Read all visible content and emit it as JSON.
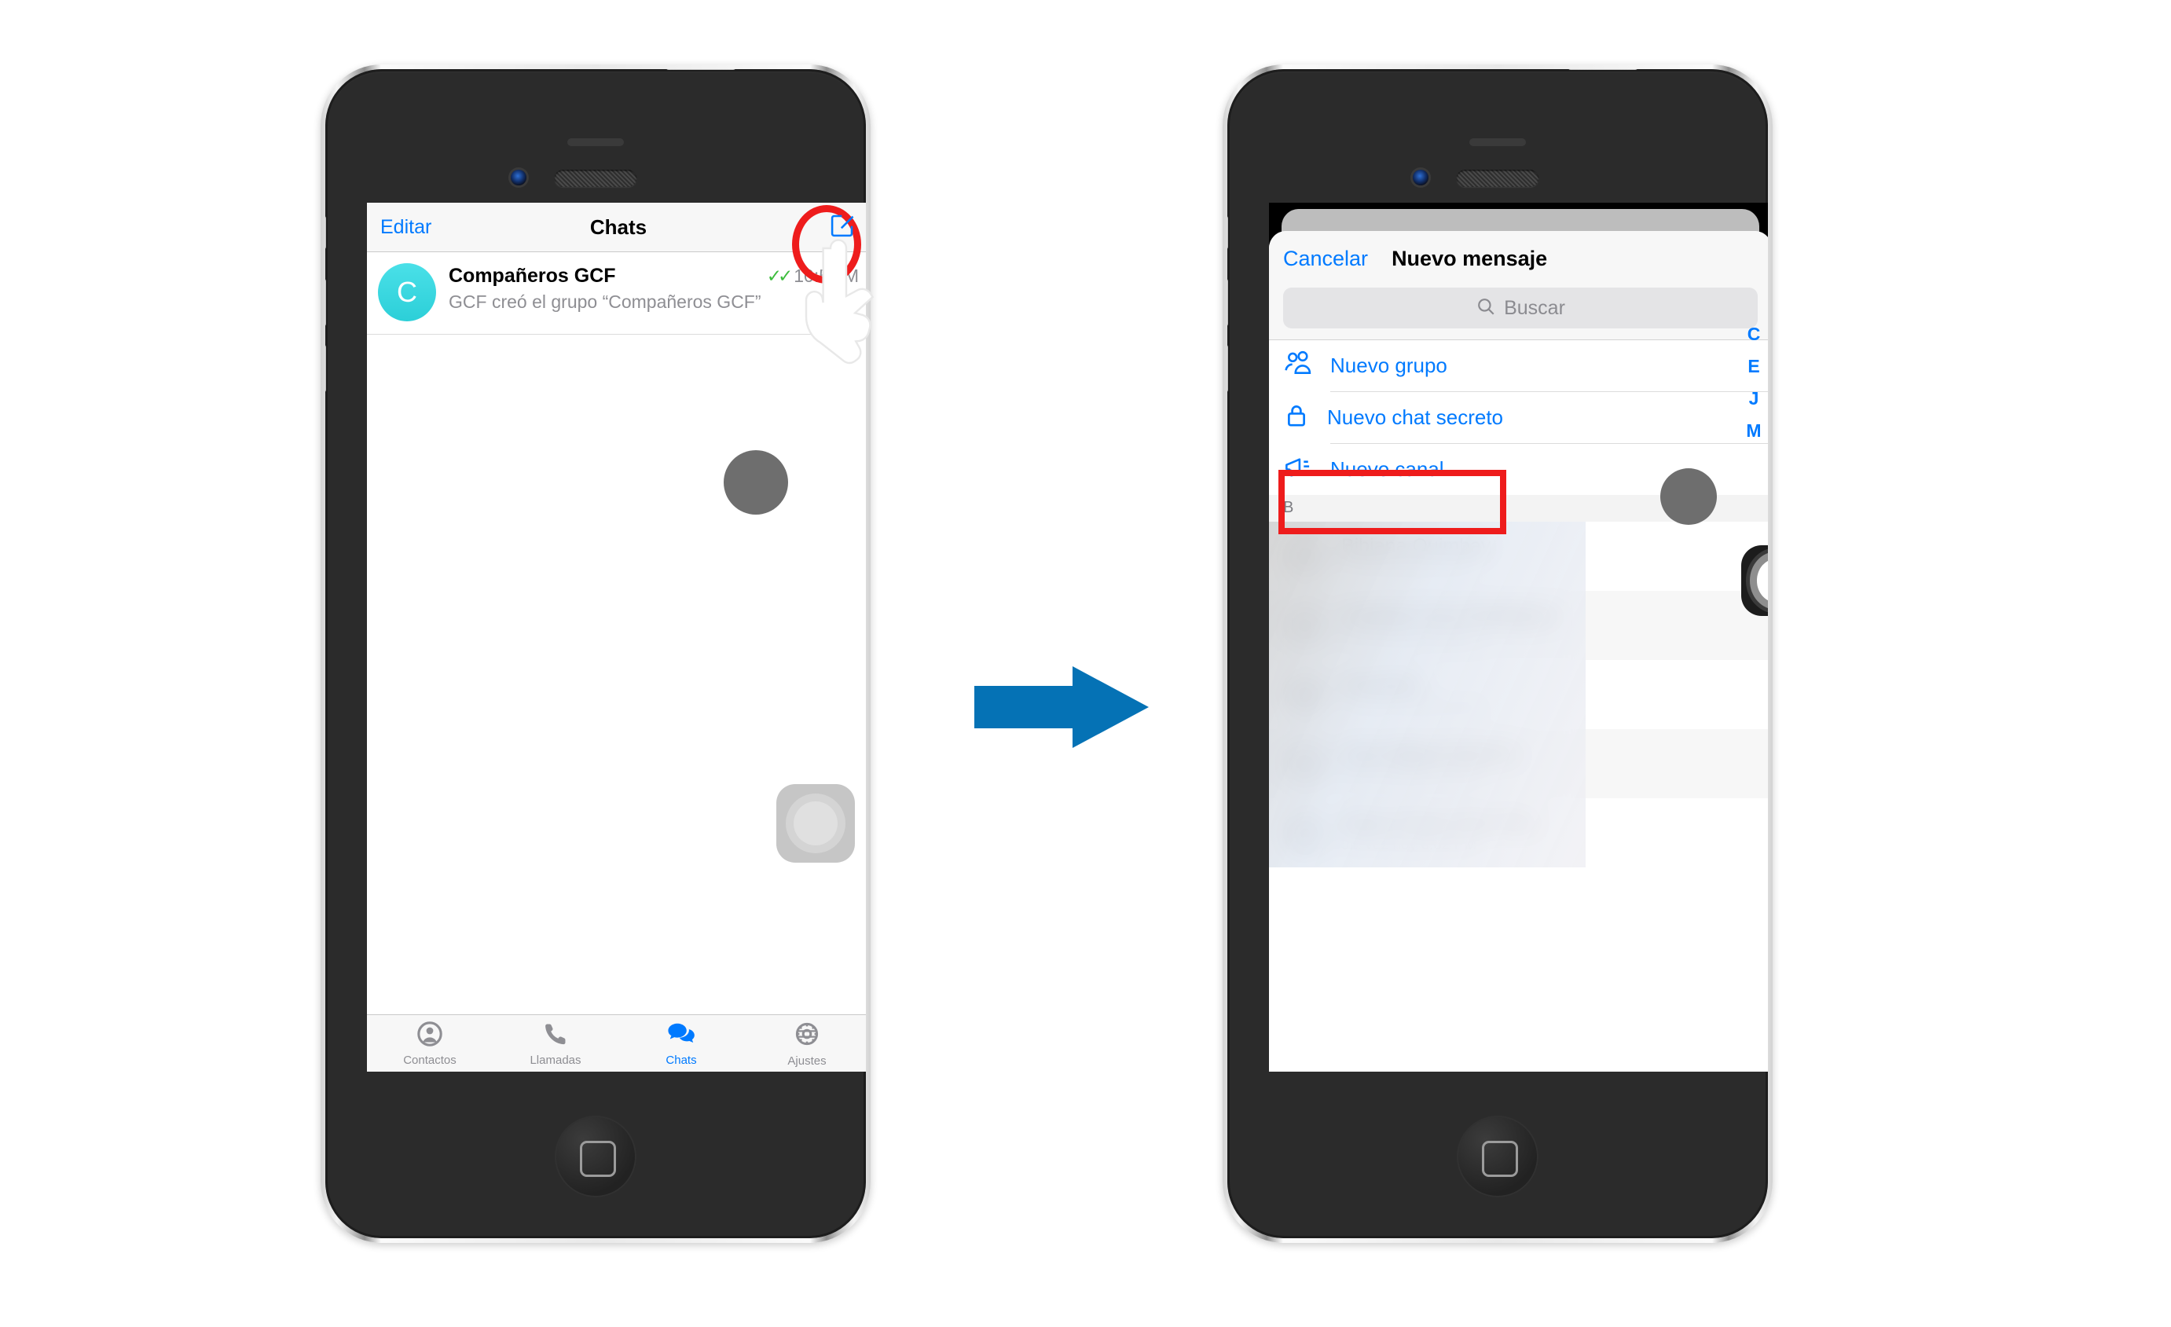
{
  "phone1": {
    "nav": {
      "left_label": "Editar",
      "title": "Chats",
      "right_icon": "compose-icon"
    },
    "chat": {
      "avatar_letter": "C",
      "name": "Compañeros GCF",
      "ticks": "✓✓",
      "time": "10:51",
      "ampm": "M",
      "preview": "GCF creó el grupo “Compañeros GCF”"
    },
    "tabs": [
      {
        "label": "Contactos",
        "icon": "contact-icon",
        "active": false
      },
      {
        "label": "Llamadas",
        "icon": "phone-icon",
        "active": false
      },
      {
        "label": "Chats",
        "icon": "chats-icon",
        "active": true
      },
      {
        "label": "Ajustes",
        "icon": "gear-icon",
        "active": false
      }
    ]
  },
  "phone2": {
    "nav": {
      "cancel_label": "Cancelar",
      "title": "Nuevo mensaje"
    },
    "search": {
      "placeholder": "Buscar",
      "icon": "search-icon"
    },
    "options": [
      {
        "label": "Nuevo grupo",
        "icon": "group-icon"
      },
      {
        "label": "Nuevo chat secreto",
        "icon": "lock-icon"
      },
      {
        "label": "Nuevo canal",
        "icon": "megaphone-icon"
      }
    ],
    "section_header": "B",
    "contacts": [
      {
        "initials": "BQ",
        "name": "Bibiana Quimbay",
        "sub": "últ. vez hace 1 hora"
      },
      {
        "initials": "CG",
        "name": "Carolina Guío Rodriguez",
        "sub": "últ. vez hoy 5:24 PM"
      },
      {
        "initials": "E",
        "name": "Elizabeth",
        "sub": "últ. vez recientemente"
      },
      {
        "initials": "JA",
        "name": "Jose Miguel Alarcón",
        "sub": "últ. vez hoy 3:10 PM"
      },
      {
        "initials": "MO",
        "name": "Maria Paula Ortiz Ruiz",
        "sub": "últ. vez hoy 6:02 PM"
      }
    ],
    "alpha_index": [
      "C",
      "E",
      "J",
      "M"
    ]
  },
  "annotations": {
    "compose_highlight": "red-ellipse-highlight",
    "new_channel_highlight": "red-rectangle-highlight",
    "step_arrow": "right-arrow-icon",
    "pointer": "pointing-hand-cursor"
  },
  "colors": {
    "ios_blue": "#007aff",
    "highlight_red": "#ee1c1c",
    "arrow_blue": "#0572b5",
    "avatar_cyan": "#2ccfd8",
    "tick_green": "#3dbd3d"
  }
}
